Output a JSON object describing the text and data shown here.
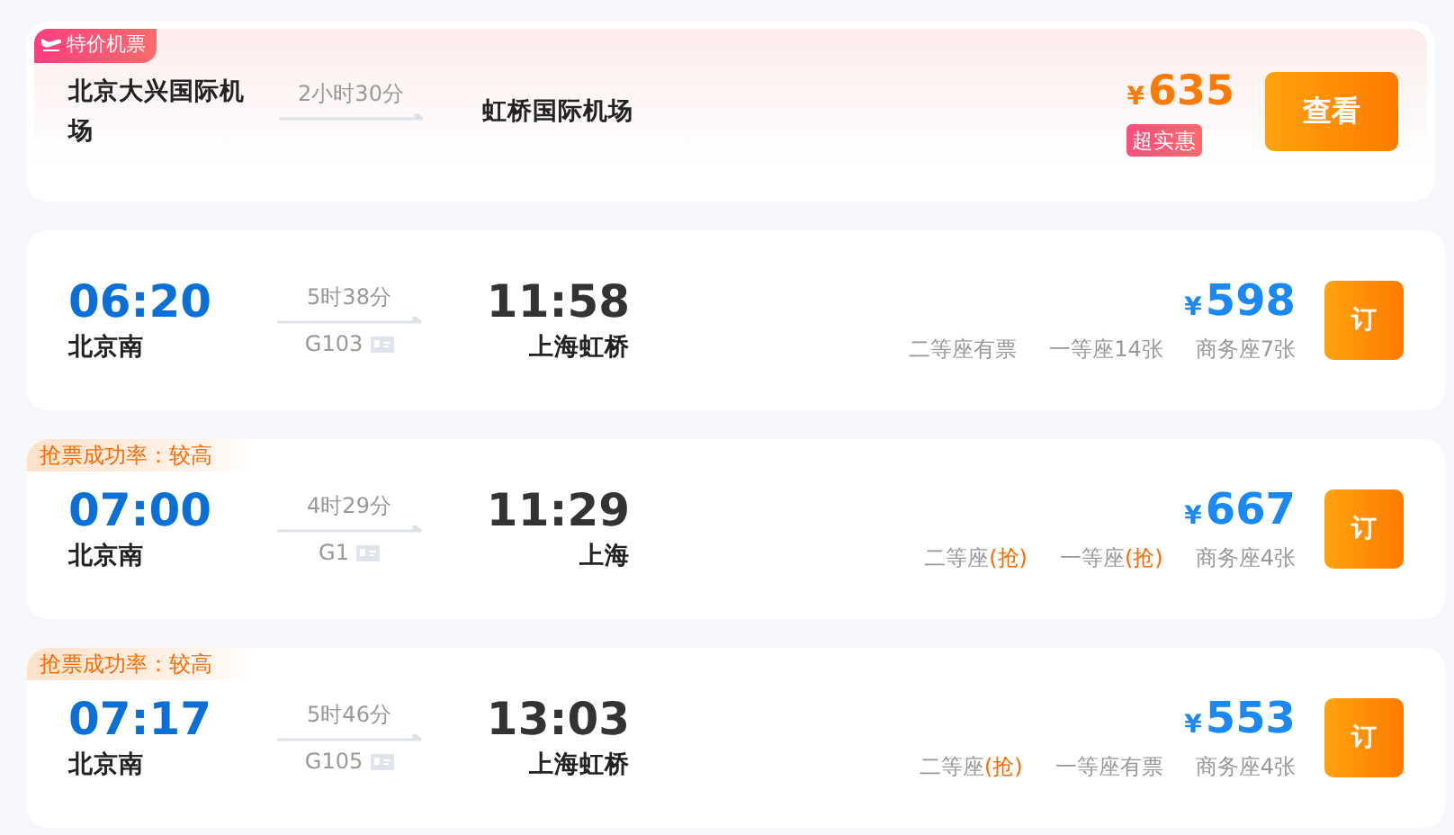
{
  "special": {
    "badge": "特价机票",
    "from": "北京大兴国际机场",
    "duration": "2小时30分",
    "to": "虹桥国际机场",
    "currency": "¥",
    "price": "635",
    "deal_tag": "超实惠",
    "button": "查看"
  },
  "trains": [
    {
      "depart_time": "06:20",
      "depart_station": "北京南",
      "duration": "5时38分",
      "number": "G103",
      "arrive_time": "11:58",
      "arrive_station": "上海虹桥",
      "currency": "¥",
      "price": "598",
      "button": "订",
      "seats": [
        {
          "kind": "available",
          "label": "二等座有票"
        },
        {
          "kind": "available",
          "label": "一等座14张"
        },
        {
          "kind": "available",
          "label": "商务座7张"
        }
      ]
    },
    {
      "tag": "抢票成功率：较高",
      "depart_time": "07:00",
      "depart_station": "北京南",
      "duration": "4时29分",
      "number": "G1",
      "arrive_time": "11:29",
      "arrive_station": "上海",
      "currency": "¥",
      "price": "667",
      "button": "订",
      "seats": [
        {
          "kind": "grab",
          "label": "二等座",
          "status": "(抢)"
        },
        {
          "kind": "grab",
          "label": "一等座",
          "status": "(抢)"
        },
        {
          "kind": "available",
          "label": "商务座4张"
        }
      ]
    },
    {
      "tag": "抢票成功率：较高",
      "depart_time": "07:17",
      "depart_station": "北京南",
      "duration": "5时46分",
      "number": "G105",
      "arrive_time": "13:03",
      "arrive_station": "上海虹桥",
      "currency": "¥",
      "price": "553",
      "button": "订",
      "seats": [
        {
          "kind": "grab",
          "label": "二等座",
          "status": "(抢)"
        },
        {
          "kind": "available",
          "label": "一等座有票"
        },
        {
          "kind": "available",
          "label": "商务座4张"
        }
      ]
    }
  ]
}
